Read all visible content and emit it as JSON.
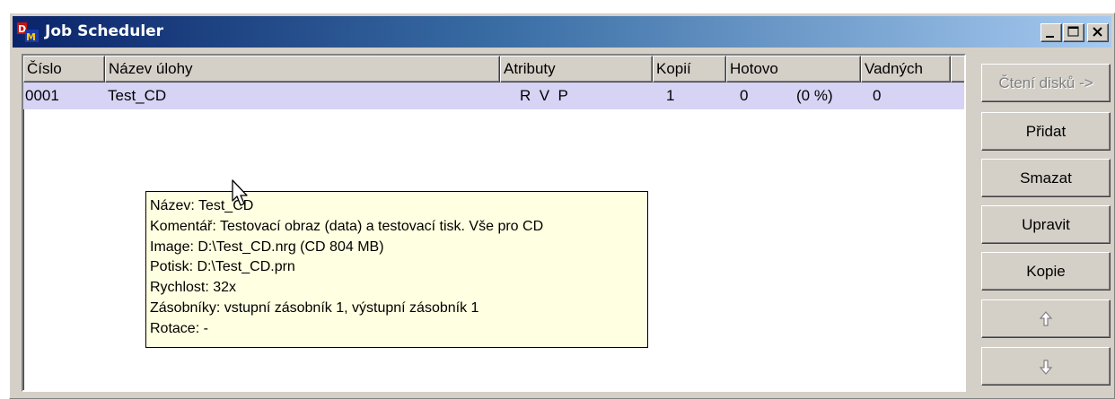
{
  "window": {
    "title": "Job Scheduler",
    "app_icon_letters": "DM",
    "controls": [
      "minimize",
      "maximize",
      "close"
    ]
  },
  "columns": [
    "Číslo",
    "Název úlohy",
    "Atributy",
    "Kopií",
    "Hotovo",
    "Vadných"
  ],
  "jobs": [
    {
      "cislo": "0001",
      "nazev": "Test_CD",
      "atributy": "R  V  P",
      "kopii": "1",
      "hotovo": "0",
      "hotovo_pct": "(0 %)",
      "vadnych": "0",
      "selected": true
    }
  ],
  "tooltip": {
    "lines": [
      "Název:  Test_CD",
      "Komentář:  Testovací obraz (data) a testovací tisk. Vše pro CD",
      "Image:  D:\\Test_CD.nrg (CD 804 MB)",
      "Potisk:  D:\\Test_CD.prn",
      "Rychlost:  32x",
      "Zásobníky:  vstupní zásobník 1, výstupní zásobník 1",
      "Rotace:  -"
    ]
  },
  "buttons": {
    "cteni_disku": "Čtení disků ->",
    "pridat": "Přidat",
    "smazat": "Smazat",
    "upravit": "Upravit",
    "kopie": "Kopie",
    "move_up_icon": "arrow-up-icon",
    "move_down_icon": "arrow-down-icon"
  },
  "colors": {
    "titlebar_start": "#0a246a",
    "titlebar_end": "#a6caf0",
    "selected_row": "#d6d3f4",
    "tooltip_bg": "#ffffe1",
    "face": "#d4d0c8"
  }
}
